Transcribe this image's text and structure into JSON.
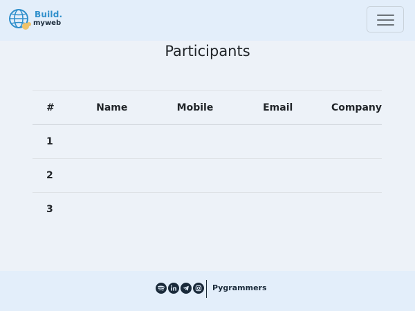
{
  "navbar": {
    "brand_line1": "Build.",
    "brand_line2": "myweb",
    "menu_icon": "hamburger-menu-icon"
  },
  "page": {
    "title": "Participants"
  },
  "table": {
    "headers": [
      "#",
      "Name",
      "Mobile",
      "Email",
      "Company"
    ],
    "rows": [
      [
        "1",
        "",
        "",
        "",
        ""
      ],
      [
        "2",
        "",
        "",
        "",
        ""
      ],
      [
        "3",
        "",
        "",
        "",
        ""
      ]
    ]
  },
  "footer": {
    "social_icons": [
      "spotify-icon",
      "linkedin-icon",
      "telegram-icon",
      "instagram-icon"
    ],
    "text": "Pygrammers"
  },
  "colors": {
    "background": "#edf2f8",
    "navbar_bg": "#e3eefa",
    "brand_accent": "#2f8fcb",
    "brand_highlight": "#f0c36a",
    "icon_color": "#1a2a3a"
  }
}
